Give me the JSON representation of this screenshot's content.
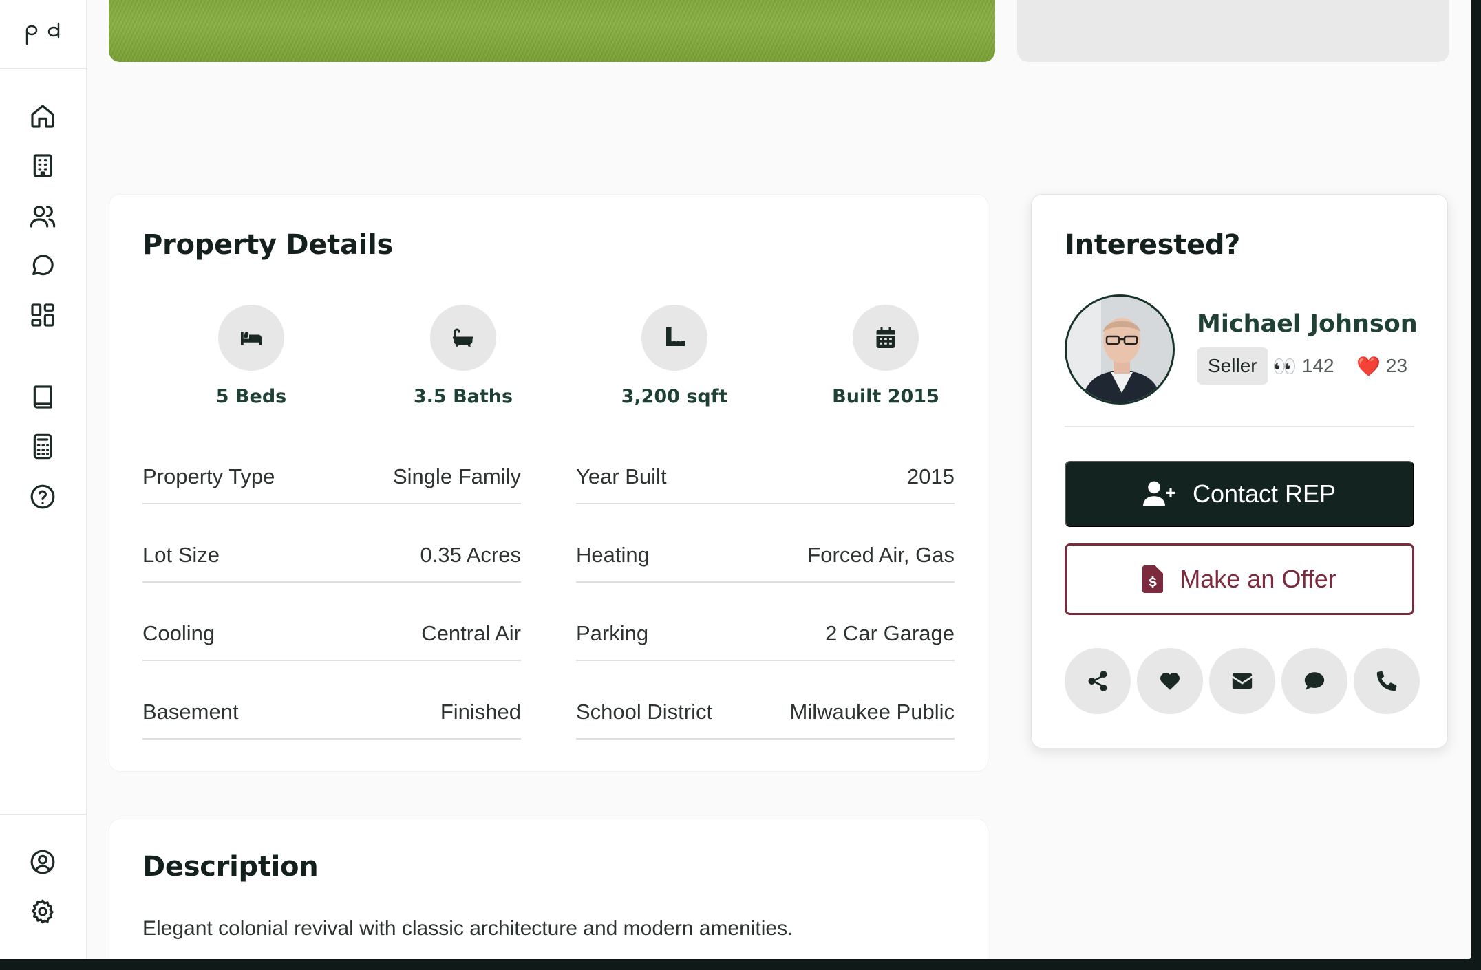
{
  "sidebar": {
    "logo_icon": "pd-logo",
    "items": [
      {
        "icon": "home-icon"
      },
      {
        "icon": "building-icon"
      },
      {
        "icon": "users-icon"
      },
      {
        "icon": "chat-icon"
      },
      {
        "icon": "dashboard-icon"
      },
      {
        "icon": "book-icon"
      },
      {
        "icon": "calculator-icon"
      },
      {
        "icon": "help-icon"
      }
    ],
    "bottom_items": [
      {
        "icon": "profile-icon"
      },
      {
        "icon": "settings-icon"
      }
    ]
  },
  "details": {
    "title": "Property Details",
    "stats": [
      {
        "icon": "bed-icon",
        "label": "5 Beds"
      },
      {
        "icon": "bath-icon",
        "label": "3.5 Baths"
      },
      {
        "icon": "ruler-icon",
        "label": "3,200 sqft"
      },
      {
        "icon": "calendar-icon",
        "label": "Built 2015"
      }
    ],
    "left_rows": [
      {
        "key": "Property Type",
        "value": "Single Family"
      },
      {
        "key": "Lot Size",
        "value": "0.35 Acres"
      },
      {
        "key": "Cooling",
        "value": "Central Air"
      },
      {
        "key": "Basement",
        "value": "Finished"
      }
    ],
    "right_rows": [
      {
        "key": "Year Built",
        "value": "2015"
      },
      {
        "key": "Heating",
        "value": "Forced Air, Gas"
      },
      {
        "key": "Parking",
        "value": "2 Car Garage"
      },
      {
        "key": "School District",
        "value": "Milwaukee Public"
      }
    ]
  },
  "description": {
    "title": "Description",
    "text": "Elegant colonial revival with classic architecture and modern amenities."
  },
  "contact": {
    "title": "Interested?",
    "agent_name": "Michael Johnson",
    "role_badge": "Seller",
    "views_emoji": "👀",
    "views": "142",
    "likes_emoji": "❤️",
    "likes": "23",
    "contact_button": "Contact REP",
    "offer_button": "Make an Offer",
    "actions": [
      "share-icon",
      "heart-icon",
      "envelope-icon",
      "comment-icon",
      "phone-icon"
    ]
  }
}
